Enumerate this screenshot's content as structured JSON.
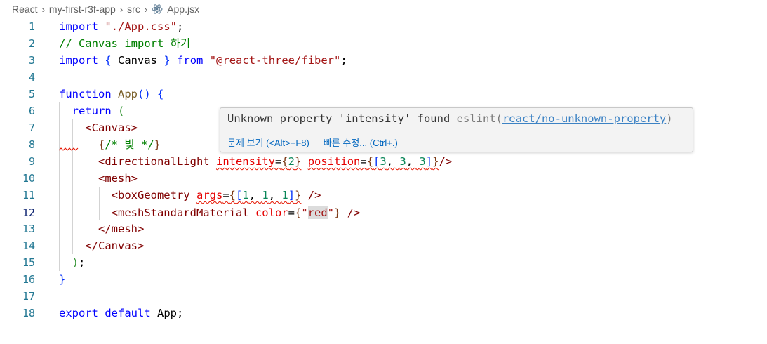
{
  "breadcrumb": {
    "items": [
      "React",
      "my-first-r3f-app",
      "src",
      "App.jsx"
    ],
    "file_icon": "react-icon"
  },
  "lines": [
    {
      "n": "1",
      "t": [
        [
          "kw",
          "import"
        ],
        [
          "txt",
          " "
        ],
        [
          "str",
          "\"./App.css\""
        ],
        [
          "txt",
          ";"
        ]
      ]
    },
    {
      "n": "2",
      "t": [
        [
          "cmt",
          "// Canvas import 하기"
        ]
      ]
    },
    {
      "n": "3",
      "t": [
        [
          "kw",
          "import"
        ],
        [
          "txt",
          " "
        ],
        [
          "br",
          "{"
        ],
        [
          "txt",
          " Canvas "
        ],
        [
          "br",
          "}"
        ],
        [
          "txt",
          " "
        ],
        [
          "kw",
          "from"
        ],
        [
          "txt",
          " "
        ],
        [
          "str",
          "\"@react-three/fiber\""
        ],
        [
          "txt",
          ";"
        ]
      ]
    },
    {
      "n": "4",
      "t": []
    },
    {
      "n": "5",
      "t": [
        [
          "kw",
          "function"
        ],
        [
          "txt",
          " "
        ],
        [
          "fn",
          "App"
        ],
        [
          "br",
          "()"
        ],
        [
          "txt",
          " "
        ],
        [
          "br",
          "{"
        ]
      ]
    },
    {
      "n": "6",
      "t": [
        [
          "txt",
          "  "
        ],
        [
          "kw",
          "return"
        ],
        [
          "txt",
          " "
        ],
        [
          "br2",
          "("
        ]
      ]
    },
    {
      "n": "7",
      "t": [
        [
          "txt",
          "    "
        ],
        [
          "tag",
          "<Canvas>"
        ]
      ]
    },
    {
      "n": "8",
      "t": [
        [
          "txt",
          "      "
        ],
        [
          "br3",
          "{"
        ],
        [
          "cmt",
          "/* 빛 */"
        ],
        [
          "br3",
          "}"
        ]
      ]
    },
    {
      "n": "9",
      "t": [
        [
          "txt",
          "      "
        ],
        [
          "tag",
          "<directionalLight"
        ],
        [
          "txt",
          " "
        ],
        [
          "attr squig",
          "intensity"
        ],
        [
          "txt squig",
          "="
        ],
        [
          "br3 squig",
          "{"
        ],
        [
          "num squig",
          "2"
        ],
        [
          "br3 squig",
          "}"
        ],
        [
          "txt",
          " "
        ],
        [
          "attr squig",
          "position"
        ],
        [
          "txt squig",
          "="
        ],
        [
          "br3 squig",
          "{"
        ],
        [
          "br squig",
          "["
        ],
        [
          "num squig",
          "3"
        ],
        [
          "txt squig",
          ", "
        ],
        [
          "num squig",
          "3"
        ],
        [
          "txt squig",
          ", "
        ],
        [
          "num squig",
          "3"
        ],
        [
          "br squig",
          "]"
        ],
        [
          "br3 squig",
          "}"
        ],
        [
          "tag",
          "/>"
        ]
      ]
    },
    {
      "n": "10",
      "t": [
        [
          "txt",
          "      "
        ],
        [
          "tag",
          "<mesh>"
        ]
      ]
    },
    {
      "n": "11",
      "t": [
        [
          "txt",
          "        "
        ],
        [
          "tag",
          "<boxGeometry"
        ],
        [
          "txt",
          " "
        ],
        [
          "attr squig",
          "args"
        ],
        [
          "txt squig",
          "="
        ],
        [
          "br3 squig",
          "{"
        ],
        [
          "br squig",
          "["
        ],
        [
          "num squig",
          "1"
        ],
        [
          "txt squig",
          ", "
        ],
        [
          "num squig",
          "1"
        ],
        [
          "txt squig",
          ", "
        ],
        [
          "num squig",
          "1"
        ],
        [
          "br squig",
          "]"
        ],
        [
          "br3 squig",
          "}"
        ],
        [
          "txt",
          " "
        ],
        [
          "tag",
          "/>"
        ]
      ]
    },
    {
      "n": "12",
      "t": [
        [
          "txt",
          "        "
        ],
        [
          "tag",
          "<meshStandardMaterial"
        ],
        [
          "txt",
          " "
        ],
        [
          "attr",
          "color"
        ],
        [
          "txt",
          "="
        ],
        [
          "br3",
          "{"
        ],
        [
          "str",
          "\""
        ],
        [
          "str hl",
          "red"
        ],
        [
          "str",
          "\""
        ],
        [
          "br3",
          "}"
        ],
        [
          "txt",
          " "
        ],
        [
          "tag",
          "/>"
        ]
      ]
    },
    {
      "n": "13",
      "t": [
        [
          "txt",
          "      "
        ],
        [
          "tag",
          "</mesh>"
        ]
      ]
    },
    {
      "n": "14",
      "t": [
        [
          "txt",
          "    "
        ],
        [
          "tag",
          "</Canvas>"
        ]
      ]
    },
    {
      "n": "15",
      "t": [
        [
          "txt",
          "  "
        ],
        [
          "br2",
          ")"
        ],
        [
          "txt",
          ";"
        ]
      ]
    },
    {
      "n": "16",
      "t": [
        [
          "br",
          "}"
        ]
      ]
    },
    {
      "n": "17",
      "t": []
    },
    {
      "n": "18",
      "t": [
        [
          "kw",
          "export"
        ],
        [
          "txt",
          " "
        ],
        [
          "kw",
          "default"
        ],
        [
          "txt",
          " App;"
        ]
      ]
    }
  ],
  "current_line": "12",
  "hover": {
    "message": "Unknown property 'intensity' found",
    "source": "eslint(",
    "rule": "react/no-unknown-property",
    "source_end": ")",
    "actions": [
      "문제 보기 (<Alt>+F8)",
      "빠른 수정... (Ctrl+.)"
    ]
  }
}
